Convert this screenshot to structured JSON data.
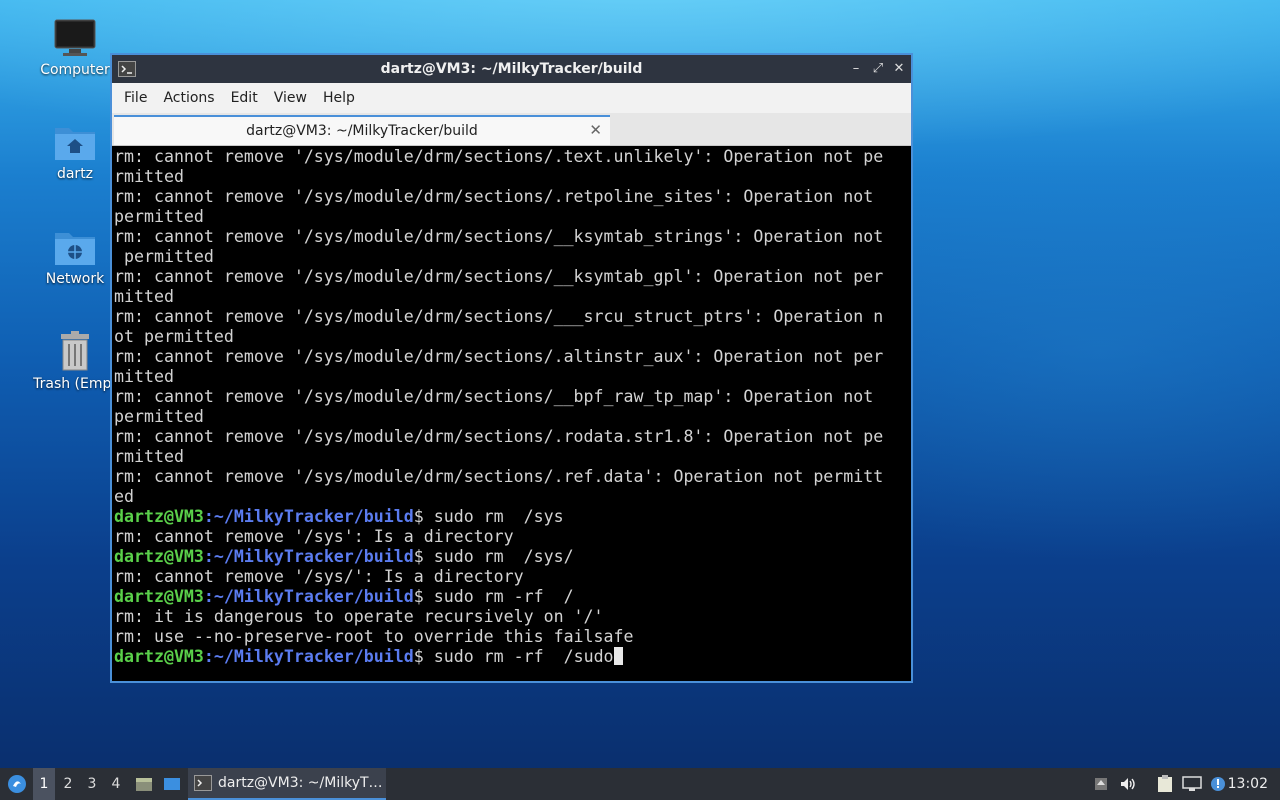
{
  "desktop": {
    "icons": [
      {
        "label": "Computer"
      },
      {
        "label": "dartz"
      },
      {
        "label": "Network"
      },
      {
        "label": "Trash (Empt"
      }
    ]
  },
  "window": {
    "title": "dartz@VM3: ~/MilkyTracker/build",
    "buttons": {
      "minimize": "–",
      "maximize": "⤢",
      "close": "✕"
    },
    "menu": [
      "File",
      "Actions",
      "Edit",
      "View",
      "Help"
    ],
    "tab": {
      "label": "dartz@VM3: ~/MilkyTracker/build",
      "close": "✕"
    }
  },
  "terminal": {
    "output_lines": [
      "rm: cannot remove '/sys/module/drm/sections/.text.unlikely': Operation not pe",
      "rmitted",
      "rm: cannot remove '/sys/module/drm/sections/.retpoline_sites': Operation not",
      "permitted",
      "rm: cannot remove '/sys/module/drm/sections/__ksymtab_strings': Operation not",
      " permitted",
      "rm: cannot remove '/sys/module/drm/sections/__ksymtab_gpl': Operation not per",
      "mitted",
      "rm: cannot remove '/sys/module/drm/sections/___srcu_struct_ptrs': Operation n",
      "ot permitted",
      "rm: cannot remove '/sys/module/drm/sections/.altinstr_aux': Operation not per",
      "mitted",
      "rm: cannot remove '/sys/module/drm/sections/__bpf_raw_tp_map': Operation not",
      "permitted",
      "rm: cannot remove '/sys/module/drm/sections/.rodata.str1.8': Operation not pe",
      "rmitted",
      "rm: cannot remove '/sys/module/drm/sections/.ref.data': Operation not permitt",
      "ed"
    ],
    "prompt": {
      "user": "dartz@VM3",
      "sep": ":",
      "path": "~/MilkyTracker/build",
      "sign": "$"
    },
    "session": [
      {
        "cmd": " sudo rm  /sys",
        "out": [
          "rm: cannot remove '/sys': Is a directory"
        ]
      },
      {
        "cmd": " sudo rm  /sys/",
        "out": [
          "rm: cannot remove '/sys/': Is a directory"
        ]
      },
      {
        "cmd": " sudo rm -rf  /",
        "out": [
          "rm: it is dangerous to operate recursively on '/'",
          "rm: use --no-preserve-root to override this failsafe"
        ]
      }
    ],
    "current_input": " sudo rm -rf  /sudo"
  },
  "taskbar": {
    "workspaces": [
      "1",
      "2",
      "3",
      "4"
    ],
    "active_workspace": "1",
    "task_label": "dartz@VM3: ~/MilkyT…",
    "clock": "13:02"
  }
}
